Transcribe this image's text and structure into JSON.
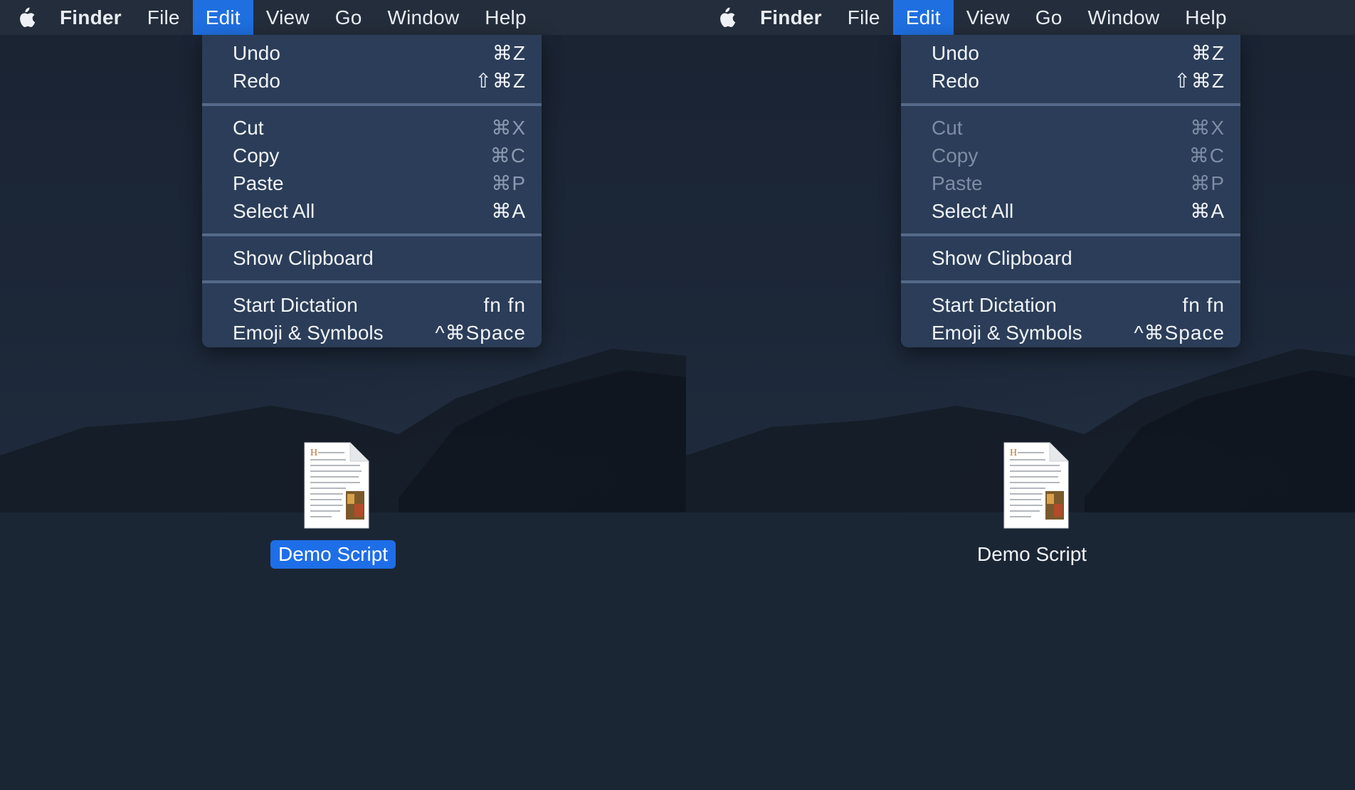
{
  "menubar": {
    "app_name": "Finder",
    "items": [
      "File",
      "Edit",
      "View",
      "Go",
      "Window",
      "Help"
    ],
    "active_item": "Edit"
  },
  "edit_menu": {
    "undo": {
      "label": "Undo",
      "shortcut": "⌘Z"
    },
    "redo": {
      "label": "Redo",
      "shortcut": "⇧⌘Z"
    },
    "cut": {
      "label": "Cut",
      "shortcut": "⌘X"
    },
    "copy": {
      "label": "Copy",
      "shortcut": "⌘C"
    },
    "paste": {
      "label": "Paste",
      "shortcut": "⌘P"
    },
    "select_all": {
      "label": "Select All",
      "shortcut": "⌘A"
    },
    "show_clipboard": {
      "label": "Show Clipboard",
      "shortcut": ""
    },
    "start_dictation": {
      "label": "Start Dictation",
      "shortcut": "fn fn"
    },
    "emoji_symbols": {
      "label": "Emoji & Symbols",
      "shortcut": "^⌘Space"
    }
  },
  "desktop": {
    "file_name": "Demo Script",
    "left_selected": true,
    "right_selected": false
  },
  "colors": {
    "menubar_active": "#1f6fe0",
    "menu_bg": "#2c3e59",
    "selection": "#1e6ee8",
    "disabled_text": "#7d8da5"
  }
}
